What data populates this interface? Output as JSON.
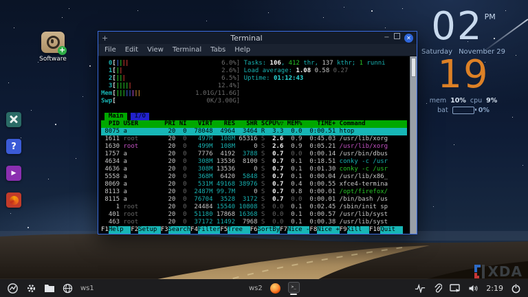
{
  "desktop": {
    "software_icon_label": "Software",
    "watermark": "XDA",
    "side_icons": [
      {
        "name": "tools-icon",
        "color": "#2a6b66"
      },
      {
        "name": "help-icon",
        "color": "#3b5bd6",
        "glyph": "?"
      },
      {
        "name": "media-player-icon",
        "color": "#8b2fb0",
        "glyph": "▶"
      },
      {
        "name": "firefox-swirl-icon",
        "color": "#c23b2a"
      }
    ],
    "clock": {
      "hour": "02",
      "ampm": "PM",
      "day": "Saturday",
      "date": "November 29",
      "minute": "19",
      "mem_label": "mem",
      "mem_value": "10%",
      "cpu_label": "cpu",
      "cpu_value": "9%",
      "bat_label": "bat",
      "bat_value": "0%"
    },
    "colors": {
      "xda_blue": "#2e6fd0",
      "xda_red": "#d03a3a",
      "clock_blue": "#c9daee",
      "clock_orange": "#dd8126"
    }
  },
  "window": {
    "title": "Terminal",
    "new_tab": "+",
    "buttons": {
      "minimize": "−",
      "close": "✕"
    },
    "menu": [
      "File",
      "Edit",
      "View",
      "Terminal",
      "Tabs",
      "Help"
    ]
  },
  "htop": {
    "meters": [
      {
        "label": "0",
        "bars": "bgrr",
        "value": "6.0%]"
      },
      {
        "label": "1",
        "bars": "gr",
        "value": "2.6%]"
      },
      {
        "label": "2",
        "bars": "ggr",
        "value": "6.5%]"
      },
      {
        "label": "3",
        "bars": "ggggr",
        "value": "12.4%]"
      },
      {
        "label": "Mem",
        "bars": "gggbbmoo",
        "value": "1.01G/11.6G]"
      },
      {
        "label": "Swp",
        "bars": "",
        "value": "0K/3.00G]"
      }
    ],
    "info_lines": [
      [
        [
          "Tasks: ",
          "cy"
        ],
        [
          "106",
          "bw"
        ],
        [
          ", ",
          "cy"
        ],
        [
          "412",
          "gn"
        ],
        [
          " thr, ",
          "cy"
        ],
        [
          "137",
          "w"
        ],
        [
          " kthr; ",
          "cy"
        ],
        [
          "1",
          "gn"
        ],
        [
          " runni",
          "cy"
        ]
      ],
      [
        [
          "Load average: ",
          "cy"
        ],
        [
          "1.08",
          "bw"
        ],
        [
          " 0.58",
          "w"
        ],
        [
          " 0.27",
          "gy"
        ]
      ],
      [
        [
          "Uptime: ",
          "cy"
        ],
        [
          "01:12:43",
          "bc"
        ]
      ]
    ],
    "tabs": [
      {
        "label": "Main",
        "active": true
      },
      {
        "label": "I/O",
        "active": false
      }
    ],
    "columns": [
      "PID",
      "USER",
      "PRI",
      "NI",
      "VIRT",
      "RES",
      "SHR",
      "S",
      "CPU%▽",
      "MEM%",
      "TIME+",
      "Command"
    ],
    "rows": [
      {
        "sel": true,
        "c": [
          [
            "8075",
            "w"
          ],
          [
            "a",
            "w"
          ],
          [
            "20",
            "w"
          ],
          [
            "0",
            "w"
          ],
          [
            "78048",
            "w"
          ],
          [
            "4964",
            "w"
          ],
          [
            "3464",
            "w"
          ],
          [
            "R",
            "w"
          ],
          [
            "3.3",
            "w"
          ],
          [
            "0.0",
            "w"
          ],
          [
            "0:00.51",
            "w"
          ],
          [
            "htop",
            "w"
          ]
        ]
      },
      {
        "sel": false,
        "c": [
          [
            "1611",
            "w"
          ],
          [
            "root",
            "gy"
          ],
          [
            "20",
            "w"
          ],
          [
            "0",
            "gy"
          ],
          [
            "497M",
            "cy"
          ],
          [
            "108M",
            "cy"
          ],
          [
            "65316",
            "w"
          ],
          [
            "S",
            "gy"
          ],
          [
            "2.6",
            "bw"
          ],
          [
            "0.9",
            "w"
          ],
          [
            "0:45.03",
            "w"
          ],
          [
            "/usr/lib/xorg",
            "w"
          ]
        ]
      },
      {
        "sel": false,
        "c": [
          [
            "1630",
            "w"
          ],
          [
            "root",
            "mg"
          ],
          [
            "20",
            "w"
          ],
          [
            "0",
            "gy"
          ],
          [
            "499M",
            "cy"
          ],
          [
            "108M",
            "cy"
          ],
          [
            "0",
            "w"
          ],
          [
            "S",
            "gy"
          ],
          [
            "2.6",
            "bw"
          ],
          [
            "0.9",
            "w"
          ],
          [
            "0:05.21",
            "w"
          ],
          [
            "/usr/lib/xorg",
            "mg"
          ]
        ]
      },
      {
        "sel": false,
        "c": [
          [
            "1757",
            "w"
          ],
          [
            "a",
            "w"
          ],
          [
            "20",
            "w"
          ],
          [
            "0",
            "gy"
          ],
          [
            "7776",
            "w"
          ],
          [
            "4192",
            "w"
          ],
          [
            "3788",
            "cy"
          ],
          [
            "S",
            "gy"
          ],
          [
            "0.7",
            "bw"
          ],
          [
            "0.0",
            "gy"
          ],
          [
            "0:00.14",
            "w"
          ],
          [
            "/usr/bin/dbus",
            "w"
          ]
        ]
      },
      {
        "sel": false,
        "c": [
          [
            "4634",
            "w"
          ],
          [
            "a",
            "w"
          ],
          [
            "20",
            "w"
          ],
          [
            "0",
            "gy"
          ],
          [
            "308M",
            "cy"
          ],
          [
            "13536",
            "w"
          ],
          [
            "8100",
            "w"
          ],
          [
            "S",
            "gy"
          ],
          [
            "0.7",
            "bw"
          ],
          [
            "0.1",
            "w"
          ],
          [
            "0:18.51",
            "w"
          ],
          [
            "conky -c /usr",
            "cy"
          ]
        ]
      },
      {
        "sel": false,
        "c": [
          [
            "4636",
            "w"
          ],
          [
            "a",
            "w"
          ],
          [
            "20",
            "w"
          ],
          [
            "0",
            "gy"
          ],
          [
            "308M",
            "cy"
          ],
          [
            "13536",
            "w"
          ],
          [
            "0",
            "w"
          ],
          [
            "S",
            "gy"
          ],
          [
            "0.7",
            "bw"
          ],
          [
            "0.1",
            "w"
          ],
          [
            "0:01.30",
            "w"
          ],
          [
            "conky -c /usr",
            "gn"
          ]
        ]
      },
      {
        "sel": false,
        "c": [
          [
            "5558",
            "w"
          ],
          [
            "a",
            "w"
          ],
          [
            "20",
            "w"
          ],
          [
            "0",
            "gy"
          ],
          [
            "368M",
            "cy"
          ],
          [
            "6420",
            "w"
          ],
          [
            "5848",
            "cy"
          ],
          [
            "S",
            "gy"
          ],
          [
            "0.7",
            "bw"
          ],
          [
            "0.1",
            "w"
          ],
          [
            "0:00.04",
            "w"
          ],
          [
            "/usr/lib/x86_",
            "w"
          ]
        ]
      },
      {
        "sel": false,
        "c": [
          [
            "8069",
            "w"
          ],
          [
            "a",
            "w"
          ],
          [
            "20",
            "w"
          ],
          [
            "0",
            "gy"
          ],
          [
            "531M",
            "cy"
          ],
          [
            "49168",
            "cy"
          ],
          [
            "38976",
            "cy"
          ],
          [
            "S",
            "gy"
          ],
          [
            "0.7",
            "bw"
          ],
          [
            "0.4",
            "w"
          ],
          [
            "0:00.55",
            "w"
          ],
          [
            "xfce4-termina",
            "w"
          ]
        ]
      },
      {
        "sel": false,
        "c": [
          [
            "8113",
            "w"
          ],
          [
            "a",
            "w"
          ],
          [
            "20",
            "w"
          ],
          [
            "0",
            "gy"
          ],
          [
            "2487M",
            "cy"
          ],
          [
            "99.7M",
            "cy"
          ],
          [
            "0",
            "w"
          ],
          [
            "S",
            "gy"
          ],
          [
            "0.7",
            "bw"
          ],
          [
            "0.8",
            "w"
          ],
          [
            "0:00.01",
            "w"
          ],
          [
            "/opt/firefox/",
            "gn"
          ]
        ]
      },
      {
        "sel": false,
        "c": [
          [
            "8115",
            "w"
          ],
          [
            "a",
            "w"
          ],
          [
            "20",
            "w"
          ],
          [
            "0",
            "gy"
          ],
          [
            "76704",
            "cy"
          ],
          [
            "3528",
            "cy"
          ],
          [
            "3172",
            "cy"
          ],
          [
            "S",
            "gy"
          ],
          [
            "0.7",
            "bw"
          ],
          [
            "0.0",
            "gy"
          ],
          [
            "0:00.01",
            "w"
          ],
          [
            "/bin/bash /us",
            "w"
          ]
        ]
      },
      {
        "sel": false,
        "c": [
          [
            "1",
            "w"
          ],
          [
            "root",
            "gy"
          ],
          [
            "20",
            "w"
          ],
          [
            "0",
            "gy"
          ],
          [
            "24484",
            "w"
          ],
          [
            "15540",
            "cy"
          ],
          [
            "10808",
            "cy"
          ],
          [
            "S",
            "gy"
          ],
          [
            "0.0",
            "gy"
          ],
          [
            "0.1",
            "w"
          ],
          [
            "0:02.45",
            "w"
          ],
          [
            "/sbin/init sp",
            "w"
          ]
        ]
      },
      {
        "sel": false,
        "c": [
          [
            "401",
            "w"
          ],
          [
            "root",
            "gy"
          ],
          [
            "20",
            "w"
          ],
          [
            "0",
            "gy"
          ],
          [
            "51180",
            "cy"
          ],
          [
            "17868",
            "w"
          ],
          [
            "16368",
            "cy"
          ],
          [
            "S",
            "gy"
          ],
          [
            "0.0",
            "gy"
          ],
          [
            "0.1",
            "w"
          ],
          [
            "0:00.57",
            "w"
          ],
          [
            "/usr/lib/syst",
            "w"
          ]
        ]
      },
      {
        "sel": false,
        "c": [
          [
            "463",
            "w"
          ],
          [
            "root",
            "gy"
          ],
          [
            "20",
            "w"
          ],
          [
            "0",
            "gy"
          ],
          [
            "37172",
            "cy"
          ],
          [
            "11492",
            "cy"
          ],
          [
            "7968",
            "w"
          ],
          [
            "S",
            "gy"
          ],
          [
            "0.0",
            "gy"
          ],
          [
            "0.1",
            "w"
          ],
          [
            "0:00.38",
            "w"
          ],
          [
            "/usr/lib/syst",
            "w"
          ]
        ]
      }
    ],
    "fkeys": [
      {
        "key": "F1",
        "label": "Help"
      },
      {
        "key": "F2",
        "label": "Setup"
      },
      {
        "key": "F3",
        "label": "Search"
      },
      {
        "key": "F4",
        "label": "Filter"
      },
      {
        "key": "F5",
        "label": "Tree"
      },
      {
        "key": "F6",
        "label": "SortBy"
      },
      {
        "key": "F7",
        "label": "Nice -"
      },
      {
        "key": "F8",
        "label": "Nice +"
      },
      {
        "key": "F9",
        "label": "Kill"
      },
      {
        "key": "F10",
        "label": "Quit"
      }
    ]
  },
  "taskbar": {
    "ws1": "ws1",
    "ws2": "ws2",
    "time": "2:19",
    "terminal_glyph": "&gt;_",
    "left_icons": [
      "app-menu-icon",
      "gear-icon",
      "folder-icon",
      "globe-icon"
    ],
    "right_icons": [
      "activity-icon",
      "paperclip-icon",
      "display-icon",
      "speaker-icon",
      "power-icon"
    ]
  }
}
